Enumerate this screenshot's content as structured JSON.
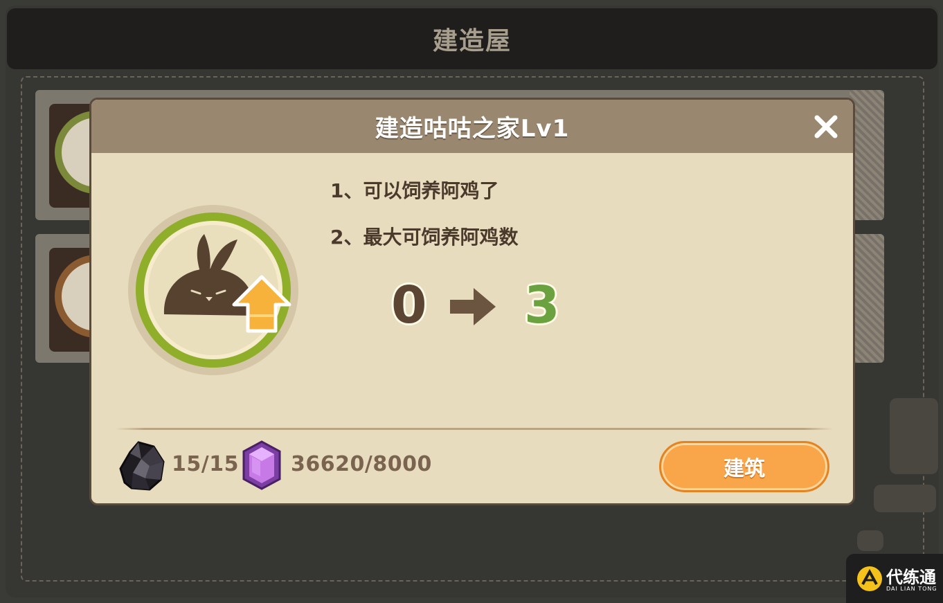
{
  "screen": {
    "title": "建造屋"
  },
  "dialog": {
    "title": "建造咕咕之家Lv1",
    "close_icon": "close-icon",
    "building_icon": "chick-house-upgrade-icon",
    "effects": [
      "1、可以饲养阿鸡了",
      "2、最大可饲养阿鸡数"
    ],
    "capacity": {
      "from": "0",
      "to": "3",
      "arrow_icon": "arrow-right-icon"
    },
    "costs": [
      {
        "icon": "ore-icon",
        "text": "15/15"
      },
      {
        "icon": "purple-gem-icon",
        "text": "36620/8000"
      }
    ],
    "build_button": "建筑"
  },
  "watermark": {
    "title": "代练通",
    "subtitle": "DAI LIAN TONG"
  },
  "colors": {
    "header": "#9a8770",
    "panel": "#e8dcbf",
    "accent_orange": "#f9a64a",
    "from_value": "#5c4633",
    "to_value": "#69a23f"
  }
}
